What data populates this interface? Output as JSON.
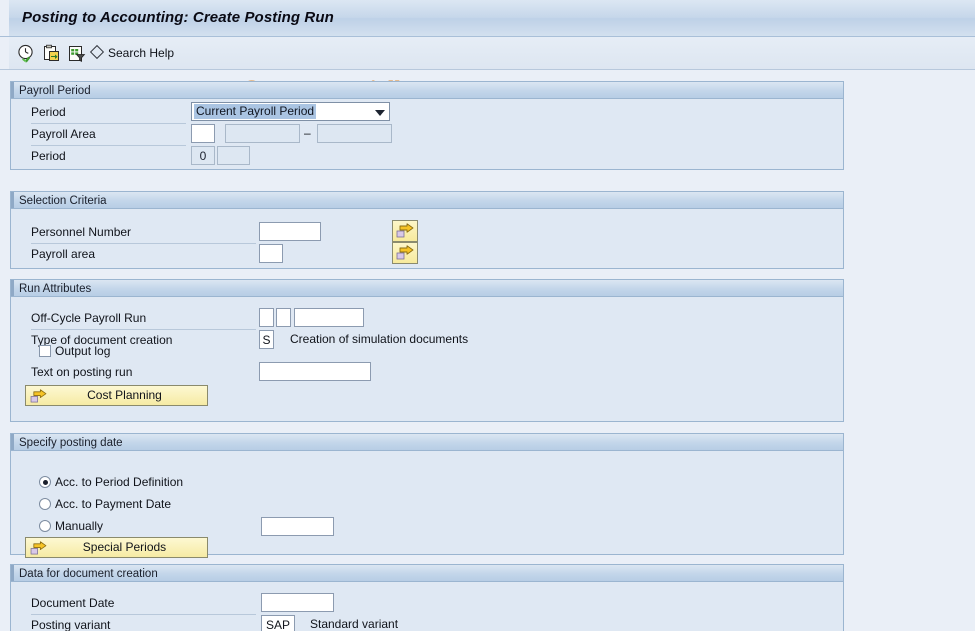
{
  "window": {
    "title": "Posting to Accounting: Create Posting Run"
  },
  "toolbar": {
    "icons": [
      {
        "name": "execute-clock-check-icon",
        "label": "Execute"
      },
      {
        "name": "copy-paste-icon",
        "label": "Copy"
      },
      {
        "name": "document-filter-icon",
        "label": "Variant"
      }
    ],
    "search_help_label": "Search Help"
  },
  "watermark": {
    "text": "© www.tutorialkart.com",
    "color": "#e5b98a"
  },
  "sections": {
    "payroll_period": {
      "title": "Payroll Period",
      "period_label": "Period",
      "period_value": "Current Payroll Period",
      "payroll_area_label": "Payroll Area",
      "payroll_area_value": "",
      "payroll_area_from": "",
      "payroll_area_to": "",
      "range_separator": "–",
      "period2_label": "Period",
      "period2_value": "0",
      "period2_extra": ""
    },
    "selection_criteria": {
      "title": "Selection Criteria",
      "personnel_number_label": "Personnel Number",
      "personnel_number_value": "",
      "payroll_area_label": "Payroll area",
      "payroll_area_value": ""
    },
    "run_attributes": {
      "title": "Run Attributes",
      "off_cycle_label": "Off-Cycle Payroll Run",
      "off_cycle_v1": "",
      "off_cycle_v2": "",
      "off_cycle_v3": "",
      "doc_type_label": "Type of document creation",
      "doc_type_value": "S",
      "doc_type_text": "Creation of simulation documents",
      "output_log_label": "Output log",
      "output_log_checked": false,
      "text_on_run_label": "Text on posting run",
      "text_on_run_value": "",
      "cost_planning_label": "Cost Planning"
    },
    "posting_date": {
      "title": "Specify posting date",
      "option_period_definition": "Acc. to Period Definition",
      "option_payment_date": "Acc. to Payment Date",
      "option_manually": "Manually",
      "selected": "period_definition",
      "manual_value": "",
      "special_periods_label": "Special Periods"
    },
    "document_creation": {
      "title": "Data for document creation",
      "document_date_label": "Document Date",
      "document_date_value": "",
      "posting_variant_label": "Posting variant",
      "posting_variant_value": "SAP",
      "posting_variant_text": "Standard variant"
    }
  },
  "theme": {
    "page_bg": "#eaeff7",
    "panel_bg": "#dfe8f3",
    "panel_border": "#9bb5d0",
    "button_yellow": "#f7ea9c",
    "selection_blue": "#aac4e2"
  }
}
